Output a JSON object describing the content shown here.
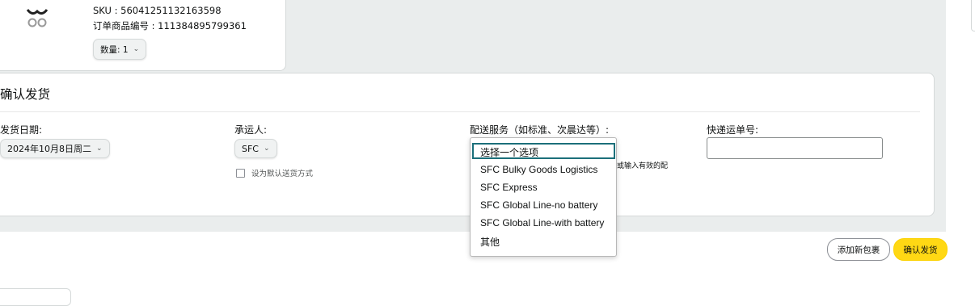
{
  "product": {
    "sku": "SKU : 56041251132163598",
    "order_item_id": "订单商品编号 : 111384895799361",
    "quantity": "数量: 1"
  },
  "confirm": {
    "title": "确认发货",
    "ship_date_label": "发货日期:",
    "ship_date_value": "2024年10月8日周二",
    "carrier_label": "承运人:",
    "carrier_value": "SFC",
    "default_carrier_checkbox": "设为默认送货方式",
    "shipping_service_label": "配送服务（如标准、次晨达等）:",
    "shipping_service_hint": "或输入有效的配",
    "tracking_label": "快递运单号:",
    "tracking_value": ""
  },
  "shipping_service_options": [
    "选择一个选项",
    "SFC Bulky Goods Logistics",
    "SFC Express",
    "SFC Global Line-no battery",
    "SFC Global Line-with battery",
    "其他"
  ],
  "actions": {
    "add_package": "添加新包裹",
    "confirm_shipment": "确认发货"
  },
  "colors": {
    "primary_button": "#ffd814",
    "focus_ring": "#1b6f7a",
    "page_background": "#eaeded"
  }
}
